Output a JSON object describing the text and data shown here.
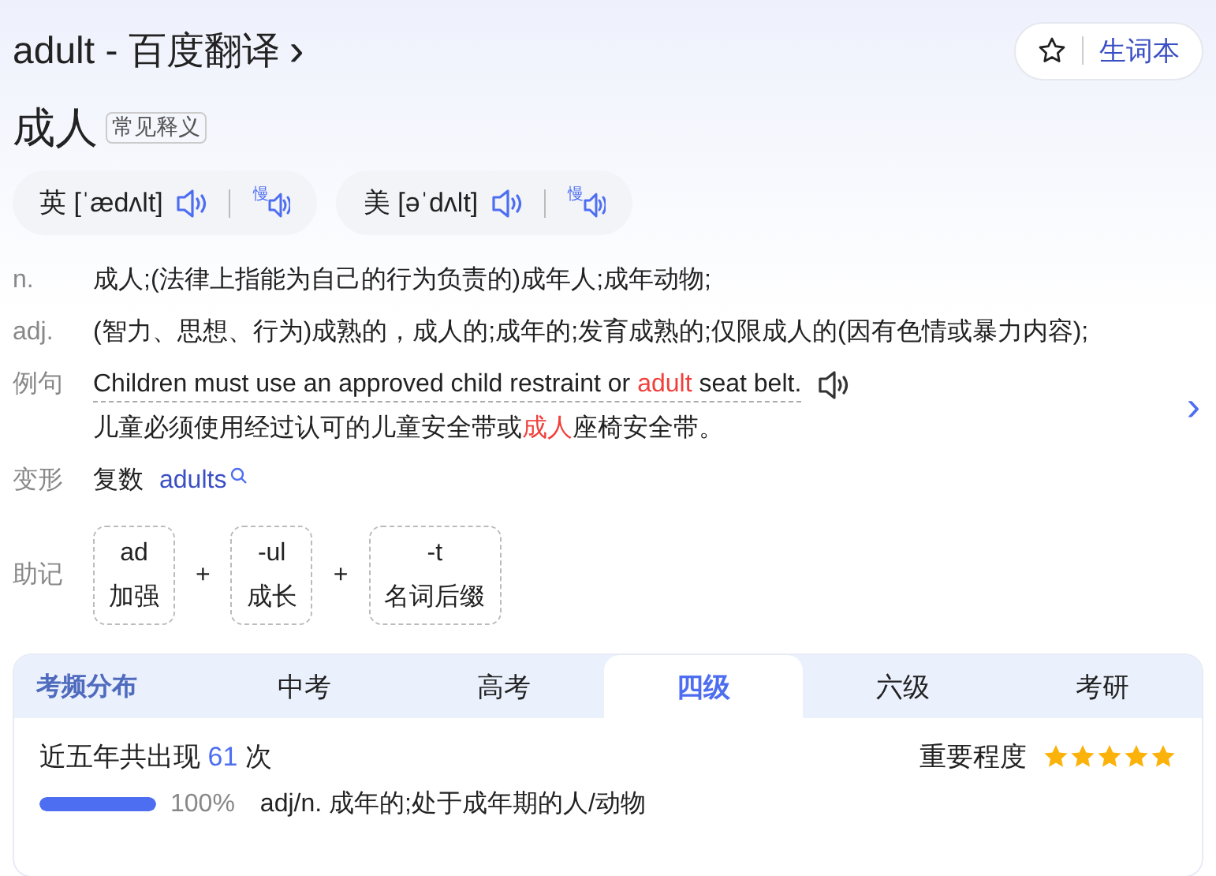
{
  "header": {
    "title": "adult - 百度翻译",
    "chevron": "›",
    "wordbook_button": "生词本"
  },
  "headword": {
    "word": "成人",
    "tag": "常见释义"
  },
  "pronunciations": [
    {
      "region": "英",
      "phonetic": "[ˈædʌlt]",
      "slow": "慢"
    },
    {
      "region": "美",
      "phonetic": "[əˈdʌlt]",
      "slow": "慢"
    }
  ],
  "definitions": [
    {
      "pos": "n.",
      "text": "成人;(法律上指能为自己的行为负责的)成年人;成年动物;"
    },
    {
      "pos": "adj.",
      "text": "(智力、思想、行为)成熟的，成人的;成年的;发育成熟的;仅限成人的(因有色情或暴力内容);"
    }
  ],
  "example": {
    "label": "例句",
    "english": [
      {
        "kind": "plain",
        "text": "Children must use an approved child restraint or "
      },
      {
        "kind": "highlight",
        "text": "adult"
      },
      {
        "kind": "plain",
        "text": " seat belt."
      }
    ],
    "chinese": [
      {
        "kind": "plain",
        "text": "儿童必须使用经过认可的儿童安全带或"
      },
      {
        "kind": "highlight",
        "text": "成人"
      },
      {
        "kind": "plain",
        "text": "座椅安全带。"
      }
    ],
    "next": "›"
  },
  "inflection": {
    "label": "变形",
    "type": "复数",
    "form": "adults"
  },
  "mnemonic": {
    "label": "助记",
    "parts": [
      {
        "root": "ad",
        "meaning": "加强"
      },
      {
        "root": "-ul",
        "meaning": "成长"
      },
      {
        "root": "-t",
        "meaning": "名词后缀"
      }
    ],
    "joiner": "+"
  },
  "exam_frequency": {
    "title": "考频分布",
    "tabs": [
      {
        "label": "中考",
        "selected": false
      },
      {
        "label": "高考",
        "selected": false
      },
      {
        "label": "四级",
        "selected": true
      },
      {
        "label": "六级",
        "selected": false
      },
      {
        "label": "考研",
        "selected": false
      }
    ],
    "count_prefix": "近五年共出现",
    "count": "61",
    "count_suffix": "次",
    "importance_label": "重要程度",
    "stars": 5,
    "usages": [
      {
        "level": 1.0,
        "percent": "100%",
        "meaning": "adj/n. 成年的;处于成年期的人/动物"
      }
    ]
  }
}
